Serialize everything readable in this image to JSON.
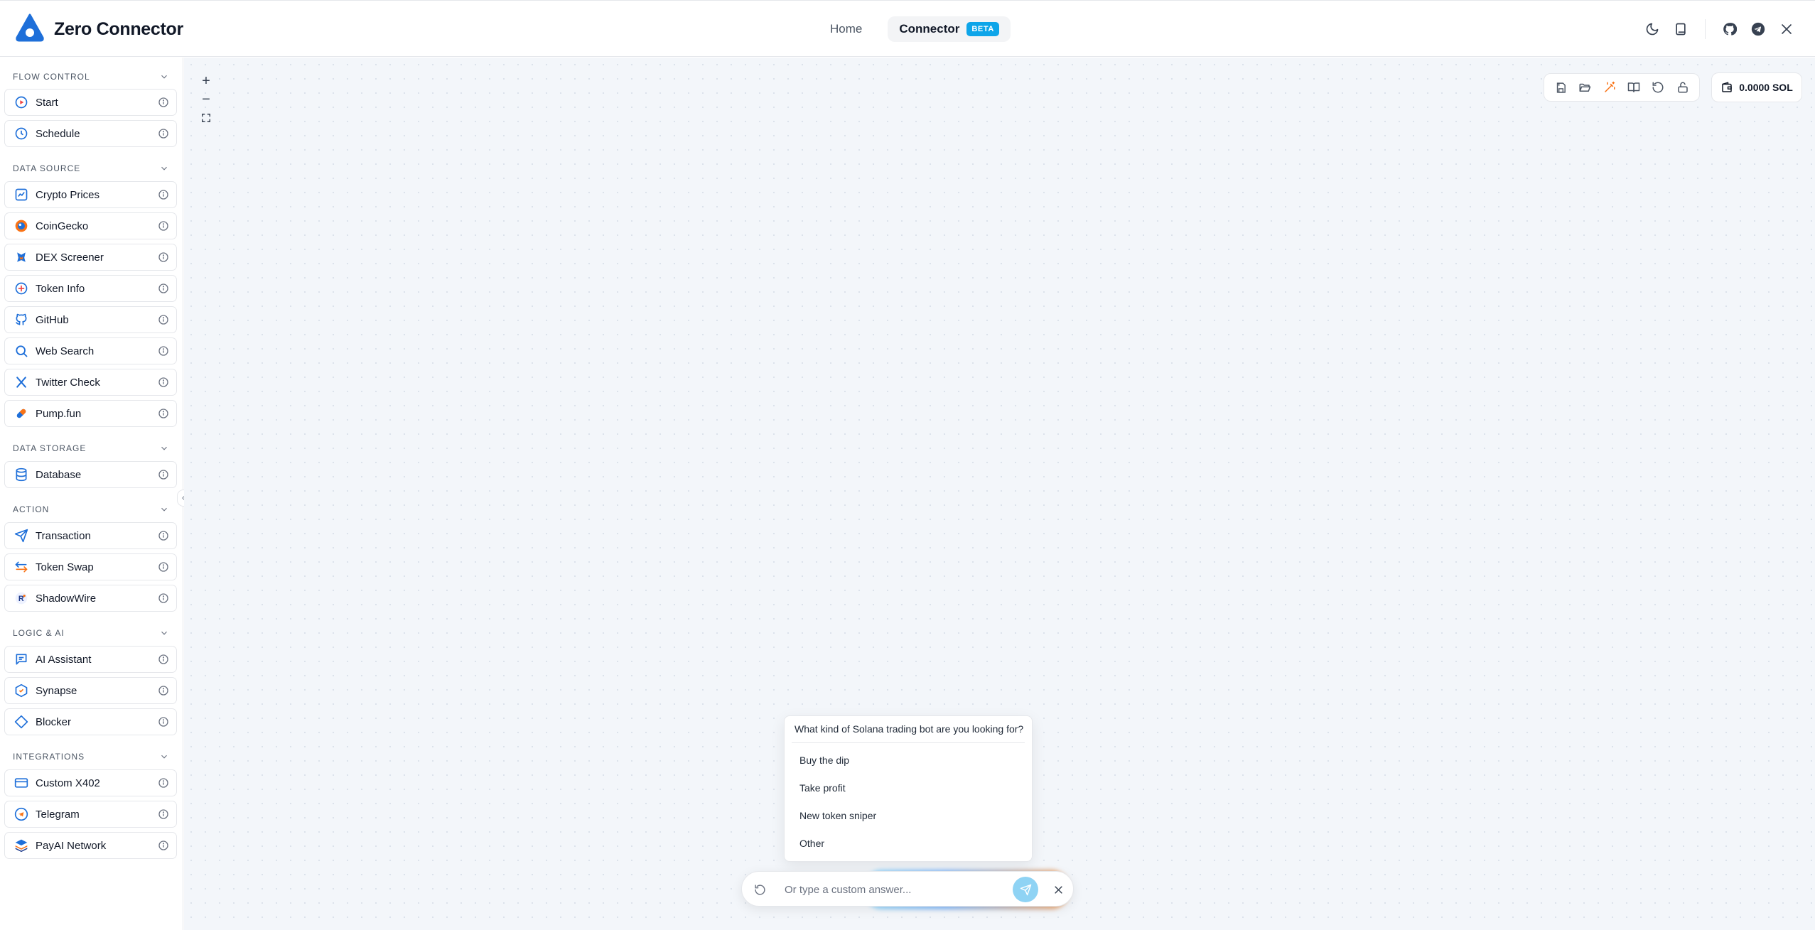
{
  "app": {
    "name": "Zero Connector",
    "colors": {
      "accent": "#0ea5e9",
      "logo": "#1e6fd9",
      "warning": "#f97316"
    }
  },
  "nav": {
    "home": "Home",
    "connector": "Connector",
    "beta": "BETA"
  },
  "header_icons": [
    "moon-icon",
    "book-icon",
    "github-icon",
    "telegram-icon",
    "x-icon"
  ],
  "sidebar": {
    "sections": [
      {
        "title": "FLOW CONTROL",
        "items": [
          {
            "label": "Start",
            "icon": "play-circle-icon"
          },
          {
            "label": "Schedule",
            "icon": "clock-icon"
          }
        ]
      },
      {
        "title": "DATA SOURCE",
        "items": [
          {
            "label": "Crypto Prices",
            "icon": "chart-line-icon"
          },
          {
            "label": "CoinGecko",
            "icon": "coingecko-icon"
          },
          {
            "label": "DEX Screener",
            "icon": "dexscreener-icon"
          },
          {
            "label": "Token Info",
            "icon": "token-icon"
          },
          {
            "label": "GitHub",
            "icon": "github-icon"
          },
          {
            "label": "Web Search",
            "icon": "search-icon"
          },
          {
            "label": "Twitter Check",
            "icon": "x-icon"
          },
          {
            "label": "Pump.fun",
            "icon": "pill-icon"
          }
        ]
      },
      {
        "title": "DATA STORAGE",
        "items": [
          {
            "label": "Database",
            "icon": "database-icon"
          }
        ]
      },
      {
        "title": "ACTION",
        "items": [
          {
            "label": "Transaction",
            "icon": "send-icon"
          },
          {
            "label": "Token Swap",
            "icon": "swap-icon"
          },
          {
            "label": "ShadowWire",
            "icon": "shadowwire-icon"
          }
        ]
      },
      {
        "title": "LOGIC & AI",
        "items": [
          {
            "label": "AI Assistant",
            "icon": "chat-icon"
          },
          {
            "label": "Synapse",
            "icon": "hexagon-icon"
          },
          {
            "label": "Blocker",
            "icon": "diamond-icon"
          }
        ]
      },
      {
        "title": "INTEGRATIONS",
        "items": [
          {
            "label": "Custom X402",
            "icon": "card-icon"
          },
          {
            "label": "Telegram",
            "icon": "telegram-icon"
          },
          {
            "label": "PayAI Network",
            "icon": "layers-icon"
          }
        ]
      }
    ]
  },
  "canvas": {
    "zoom_in": "+",
    "zoom_out": "−",
    "toolbar": [
      "save-icon",
      "folder-open-icon",
      "magic-wand-icon",
      "book-open-icon",
      "undo-icon",
      "unlock-icon"
    ],
    "balance": "0.0000 SOL"
  },
  "question": {
    "prompt": "What kind of Solana trading bot are you looking for?",
    "options": [
      "Buy the dip",
      "Take profit",
      "New token sniper",
      "Other"
    ],
    "input_placeholder": "Or type a custom answer..."
  }
}
